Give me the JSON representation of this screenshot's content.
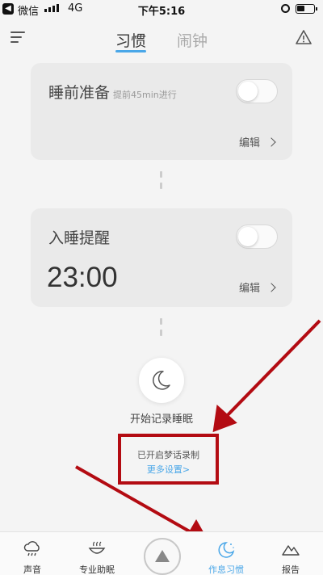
{
  "status_bar": {
    "carrier": "微信",
    "network": "4G",
    "time": "下午5:16"
  },
  "header": {
    "tabs": [
      {
        "label": "习惯",
        "active": true
      },
      {
        "label": "闹钟",
        "active": false
      }
    ],
    "icons": [
      "menu-icon",
      "warning-icon"
    ]
  },
  "cards": {
    "bedtime_prep": {
      "title": "睡前准备",
      "subtitle": "提前45min进行",
      "toggle_on": false,
      "edit_label": "编辑"
    },
    "sleep_reminder": {
      "title": "入睡提醒",
      "time": "23:00",
      "toggle_on": false,
      "edit_label": "编辑"
    }
  },
  "start_record": {
    "label": "开始记录睡眠",
    "icon": "moon-icon"
  },
  "dream_record": {
    "status": "已开启梦话录制",
    "more_link": "更多设置>"
  },
  "tabbar": {
    "items": [
      {
        "label": "声音",
        "icon": "cloud-rain-icon"
      },
      {
        "label": "专业助眠",
        "icon": "bowl-icon"
      },
      {
        "label": "",
        "icon": "triangle-play-icon"
      },
      {
        "label": "作息习惯",
        "icon": "moon-stars-icon",
        "active": true
      },
      {
        "label": "报告",
        "icon": "mountain-icon"
      }
    ]
  },
  "colors": {
    "accent": "#4aa7e8",
    "annotation": "#b30b12"
  }
}
